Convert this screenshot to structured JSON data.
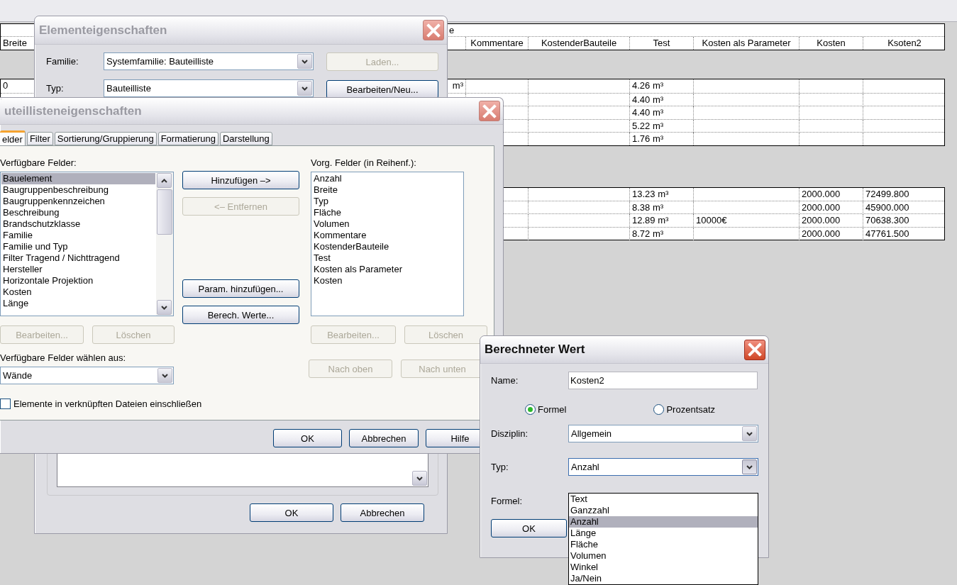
{
  "schedule": {
    "title": "e",
    "columns": [
      {
        "label": "Breite"
      },
      {},
      {
        "label": "Kommentare"
      },
      {
        "label": "KostenderBauteile"
      },
      {
        "label": "Test"
      },
      {
        "label": "Kosten als Parameter"
      },
      {
        "label": "Kosten"
      },
      {
        "label": "Ksoten2"
      }
    ],
    "groups": [
      {
        "rows": [
          [
            "0",
            "m³",
            null,
            null,
            "4.26 m³",
            null,
            null,
            null
          ],
          [
            null,
            null,
            null,
            null,
            "4.40 m³",
            null,
            null,
            null
          ],
          [
            null,
            null,
            null,
            null,
            "4.40 m³",
            null,
            null,
            null
          ],
          [
            null,
            null,
            null,
            null,
            "5.22 m³",
            null,
            null,
            null
          ],
          [
            null,
            null,
            null,
            null,
            "1.76 m³",
            null,
            null,
            null
          ]
        ]
      },
      {
        "rows": [
          [
            null,
            null,
            null,
            null,
            "13.23 m³",
            null,
            "2000.000",
            "72499.800"
          ],
          [
            null,
            null,
            null,
            null,
            "8.38 m³",
            null,
            "2000.000",
            "45900.000"
          ],
          [
            null,
            null,
            null,
            null,
            "12.89 m³",
            "10000€",
            "2000.000",
            "70638.300"
          ],
          [
            null,
            null,
            null,
            null,
            "8.72 m³",
            null,
            "2000.000",
            "47761.500"
          ]
        ]
      }
    ]
  },
  "element_properties": {
    "title": "Elementeigenschaften",
    "active": false,
    "family": {
      "label": "Familie:",
      "value": "Systemfamilie: Bauteilliste"
    },
    "type": {
      "label": "Typ:",
      "value": "Bauteilliste"
    },
    "side_buttons": [
      {
        "label": "Laden...",
        "disabled": true
      },
      {
        "label": "Bearbeiten/Neu...",
        "disabled": false
      }
    ],
    "footer_buttons": [
      {
        "label": "OK",
        "disabled": false
      },
      {
        "label": "Abbrechen",
        "disabled": false
      }
    ]
  },
  "schedule_properties": {
    "title": "uteillisteneigenschaften",
    "active": false,
    "tabs": [
      {
        "label": "elder",
        "selected": true
      },
      {
        "label": "Filter",
        "selected": false
      },
      {
        "label": "Sortierung/Gruppierung",
        "selected": false
      },
      {
        "label": "Formatierung",
        "selected": false
      },
      {
        "label": "Darstellung",
        "selected": false
      }
    ],
    "available": {
      "label": "Verfügbare Felder:",
      "items": [
        {
          "label": "Bauelement",
          "selected": true
        },
        {
          "label": "Baugruppenbeschreibung",
          "selected": false
        },
        {
          "label": "Baugruppenkennzeichen",
          "selected": false
        },
        {
          "label": "Beschreibung",
          "selected": false
        },
        {
          "label": "Brandschutzklasse",
          "selected": false
        },
        {
          "label": "Familie",
          "selected": false
        },
        {
          "label": "Familie und Typ",
          "selected": false
        },
        {
          "label": "Filter Tragend / Nichttragend",
          "selected": false
        },
        {
          "label": "Hersteller",
          "selected": false
        },
        {
          "label": "Horizontale Projektion",
          "selected": false
        },
        {
          "label": "Kosten",
          "selected": false
        },
        {
          "label": "Länge",
          "selected": false
        }
      ]
    },
    "middle_buttons": [
      {
        "label": "Hinzufügen –>",
        "disabled": false
      },
      {
        "label": "<– Entfernen",
        "disabled": true
      },
      {
        "label": "Param. hinzufügen...",
        "disabled": false
      },
      {
        "label": "Berech. Werte...",
        "disabled": false
      }
    ],
    "scheduled": {
      "label": "Vorg. Felder (in Reihenf.):",
      "items": [
        {
          "label": "Anzahl",
          "selected": false
        },
        {
          "label": "Breite",
          "selected": false
        },
        {
          "label": "Typ",
          "selected": false
        },
        {
          "label": "Fläche",
          "selected": false
        },
        {
          "label": "Volumen",
          "selected": false
        },
        {
          "label": "Kommentare",
          "selected": false
        },
        {
          "label": "KostenderBauteile",
          "selected": false
        },
        {
          "label": "Test",
          "selected": false
        },
        {
          "label": "Kosten als Parameter",
          "selected": false
        },
        {
          "label": "Kosten",
          "selected": false
        }
      ]
    },
    "left_buttons": [
      {
        "label": "Bearbeiten...",
        "disabled": true
      },
      {
        "label": "Löschen",
        "disabled": true
      }
    ],
    "right_buttons": [
      {
        "label": "Bearbeiten...",
        "disabled": true
      },
      {
        "label": "Löschen",
        "disabled": true
      }
    ],
    "move_buttons": [
      {
        "label": "Nach oben",
        "disabled": true
      },
      {
        "label": "Nach unten",
        "disabled": true
      }
    ],
    "select_from": {
      "label": "Verfügbare Felder wählen aus:",
      "value": "Wände"
    },
    "include_linked": {
      "label": "Elemente in verknüpften Dateien einschließen",
      "checked": false
    },
    "footer_buttons": [
      {
        "label": "OK",
        "disabled": false
      },
      {
        "label": "Abbrechen",
        "disabled": false
      },
      {
        "label": "Hilfe",
        "disabled": false
      }
    ]
  },
  "calculated_value": {
    "title": "Berechneter Wert",
    "active": true,
    "name": {
      "label": "Name:",
      "value": "Kosten2"
    },
    "modes": [
      {
        "label": "Formel",
        "selected": true
      },
      {
        "label": "Prozentsatz",
        "selected": false
      }
    ],
    "discipline": {
      "label": "Disziplin:",
      "value": "Allgemein"
    },
    "type": {
      "label": "Typ:",
      "value": "Anzahl",
      "expanded": true,
      "options": [
        {
          "label": "Text",
          "selected": false
        },
        {
          "label": "Ganzzahl",
          "selected": false
        },
        {
          "label": "Anzahl",
          "selected": true
        },
        {
          "label": "Länge",
          "selected": false
        },
        {
          "label": "Fläche",
          "selected": false
        },
        {
          "label": "Volumen",
          "selected": false
        },
        {
          "label": "Winkel",
          "selected": false
        },
        {
          "label": "Ja/Nein",
          "selected": false
        }
      ]
    },
    "formula": {
      "label": "Formel:"
    },
    "ok": {
      "label": "OK",
      "disabled": false
    }
  }
}
